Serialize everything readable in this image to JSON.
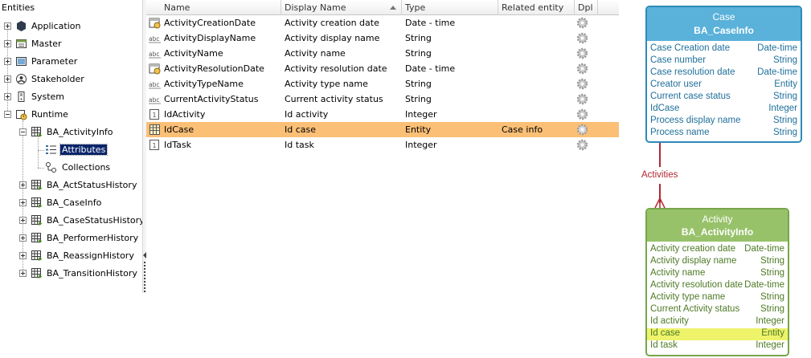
{
  "tree": {
    "title": "Entities",
    "items": [
      {
        "label": "Application",
        "icon": "hexagon-icon"
      },
      {
        "label": "Master",
        "icon": "master-entity-icon"
      },
      {
        "label": "Parameter",
        "icon": "parameter-entity-icon"
      },
      {
        "label": "Stakeholder",
        "icon": "stakeholder-icon"
      },
      {
        "label": "System",
        "icon": "system-icon"
      },
      {
        "label": "Runtime",
        "icon": "runtime-icon"
      },
      {
        "label": "BA_ActivityInfo",
        "icon": "table-entity-icon"
      },
      {
        "label": "Attributes",
        "icon": "attributes-list-icon"
      },
      {
        "label": "Collections",
        "icon": "collections-icon"
      },
      {
        "label": "BA_ActStatusHistory",
        "icon": "table-entity-icon"
      },
      {
        "label": "BA_CaseInfo",
        "icon": "table-entity-icon"
      },
      {
        "label": "BA_CaseStatusHistory",
        "icon": "table-entity-icon"
      },
      {
        "label": "BA_PerformerHistory",
        "icon": "table-entity-icon"
      },
      {
        "label": "BA_ReassignHistory",
        "icon": "table-entity-icon"
      },
      {
        "label": "BA_TransitionHistory",
        "icon": "table-entity-icon"
      }
    ]
  },
  "grid": {
    "columns": [
      "Name",
      "Display Name",
      "Type",
      "Related entity",
      "Dpl"
    ],
    "rows": [
      {
        "name": "ActivityCreationDate",
        "display": "Activity creation date",
        "type": "Date - time",
        "related": "",
        "icon": "calendar-icon"
      },
      {
        "name": "ActivityDisplayName",
        "display": "Activity display name",
        "type": "String",
        "related": "",
        "icon": "abc-icon"
      },
      {
        "name": "ActivityName",
        "display": "Activity name",
        "type": "String",
        "related": "",
        "icon": "abc-icon"
      },
      {
        "name": "ActivityResolutionDate",
        "display": "Activity resolution date",
        "type": "Date - time",
        "related": "",
        "icon": "calendar-icon"
      },
      {
        "name": "ActivityTypeName",
        "display": "Activity type name",
        "type": "String",
        "related": "",
        "icon": "abc-icon"
      },
      {
        "name": "CurrentActivityStatus",
        "display": "Current activity status",
        "type": "String",
        "related": "",
        "icon": "abc-icon"
      },
      {
        "name": "IdActivity",
        "display": "Id activity",
        "type": "Integer",
        "related": "",
        "icon": "integer-icon"
      },
      {
        "name": "IdCase",
        "display": "Id case",
        "type": "Entity",
        "related": "Case info",
        "icon": "entity-icon"
      },
      {
        "name": "IdTask",
        "display": "Id task",
        "type": "Integer",
        "related": "",
        "icon": "integer-icon"
      }
    ]
  },
  "diagram": {
    "case": {
      "title": "Case",
      "subtitle": "BA_CaseInfo",
      "attributes": [
        {
          "name": "Case Creation date",
          "type": "Date-time"
        },
        {
          "name": "Case number",
          "type": "String"
        },
        {
          "name": "Case resolution date",
          "type": "Date-time"
        },
        {
          "name": "Creator user",
          "type": "Entity"
        },
        {
          "name": "Current case status",
          "type": "String"
        },
        {
          "name": "IdCase",
          "type": "Integer"
        },
        {
          "name": "Process display name",
          "type": "String"
        },
        {
          "name": "Process name",
          "type": "String"
        }
      ]
    },
    "relationship_label": "Activities",
    "activity": {
      "title": "Activity",
      "subtitle": "BA_ActivityInfo",
      "attributes": [
        {
          "name": "Activity creation date",
          "type": "Date-time"
        },
        {
          "name": "Activity display name",
          "type": "String"
        },
        {
          "name": "Activity name",
          "type": "String"
        },
        {
          "name": "Activity resolution date",
          "type": "Date-time"
        },
        {
          "name": "Activity type name",
          "type": "String"
        },
        {
          "name": "Current Activity status",
          "type": "String"
        },
        {
          "name": "Id activity",
          "type": "Integer"
        },
        {
          "name": "Id case",
          "type": "Entity"
        },
        {
          "name": "Id task",
          "type": "Integer"
        }
      ]
    }
  },
  "colors": {
    "selection_row": "#fbbf76",
    "case_header": "#5ab1d9",
    "activity_header": "#98c26a",
    "relation": "#b4262f",
    "attribute_highlight": "#eef36a"
  }
}
